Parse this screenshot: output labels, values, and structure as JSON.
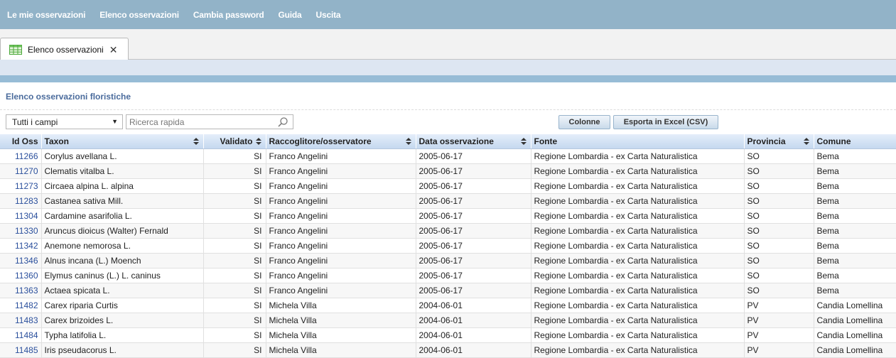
{
  "nav": [
    "Le mie osservazioni",
    "Elenco osservazioni",
    "Cambia password",
    "Guida",
    "Uscita"
  ],
  "tab": {
    "label": "Elenco osservazioni"
  },
  "section_title": "Elenco osservazioni floristiche",
  "toolbar": {
    "field_select": "Tutti i campi",
    "search_placeholder": "Ricerca rapida",
    "columns_label": "Colonne",
    "export_label": "Esporta in Excel (CSV)"
  },
  "table": {
    "headers": [
      "Id Oss",
      "Taxon",
      "Validato",
      "Raccoglitore/osservatore",
      "Data osservazione",
      "Fonte",
      "Provincia",
      "Comune"
    ],
    "rows": [
      [
        "11266",
        "Corylus avellana L.",
        "SI",
        "Franco Angelini",
        "2005-06-17",
        "Regione Lombardia - ex Carta Naturalistica",
        "SO",
        "Bema"
      ],
      [
        "11270",
        "Clematis vitalba L.",
        "SI",
        "Franco Angelini",
        "2005-06-17",
        "Regione Lombardia - ex Carta Naturalistica",
        "SO",
        "Bema"
      ],
      [
        "11273",
        "Circaea alpina L. alpina",
        "SI",
        "Franco Angelini",
        "2005-06-17",
        "Regione Lombardia - ex Carta Naturalistica",
        "SO",
        "Bema"
      ],
      [
        "11283",
        "Castanea sativa Mill.",
        "SI",
        "Franco Angelini",
        "2005-06-17",
        "Regione Lombardia - ex Carta Naturalistica",
        "SO",
        "Bema"
      ],
      [
        "11304",
        "Cardamine asarifolia L.",
        "SI",
        "Franco Angelini",
        "2005-06-17",
        "Regione Lombardia - ex Carta Naturalistica",
        "SO",
        "Bema"
      ],
      [
        "11330",
        "Aruncus dioicus (Walter) Fernald",
        "SI",
        "Franco Angelini",
        "2005-06-17",
        "Regione Lombardia - ex Carta Naturalistica",
        "SO",
        "Bema"
      ],
      [
        "11342",
        "Anemone nemorosa L.",
        "SI",
        "Franco Angelini",
        "2005-06-17",
        "Regione Lombardia - ex Carta Naturalistica",
        "SO",
        "Bema"
      ],
      [
        "11346",
        "Alnus incana (L.) Moench",
        "SI",
        "Franco Angelini",
        "2005-06-17",
        "Regione Lombardia - ex Carta Naturalistica",
        "SO",
        "Bema"
      ],
      [
        "11360",
        "Elymus caninus (L.) L. caninus",
        "SI",
        "Franco Angelini",
        "2005-06-17",
        "Regione Lombardia - ex Carta Naturalistica",
        "SO",
        "Bema"
      ],
      [
        "11363",
        "Actaea spicata L.",
        "SI",
        "Franco Angelini",
        "2005-06-17",
        "Regione Lombardia - ex Carta Naturalistica",
        "SO",
        "Bema"
      ],
      [
        "11482",
        "Carex riparia Curtis",
        "SI",
        "Michela Villa",
        "2004-06-01",
        "Regione Lombardia - ex Carta Naturalistica",
        "PV",
        "Candia Lomellina"
      ],
      [
        "11483",
        "Carex brizoides L.",
        "SI",
        "Michela Villa",
        "2004-06-01",
        "Regione Lombardia - ex Carta Naturalistica",
        "PV",
        "Candia Lomellina"
      ],
      [
        "11484",
        "Typha latifolia L.",
        "SI",
        "Michela Villa",
        "2004-06-01",
        "Regione Lombardia - ex Carta Naturalistica",
        "PV",
        "Candia Lomellina"
      ],
      [
        "11485",
        "Iris pseudacorus L.",
        "SI",
        "Michela Villa",
        "2004-06-01",
        "Regione Lombardia - ex Carta Naturalistica",
        "PV",
        "Candia Lomellina"
      ]
    ]
  }
}
